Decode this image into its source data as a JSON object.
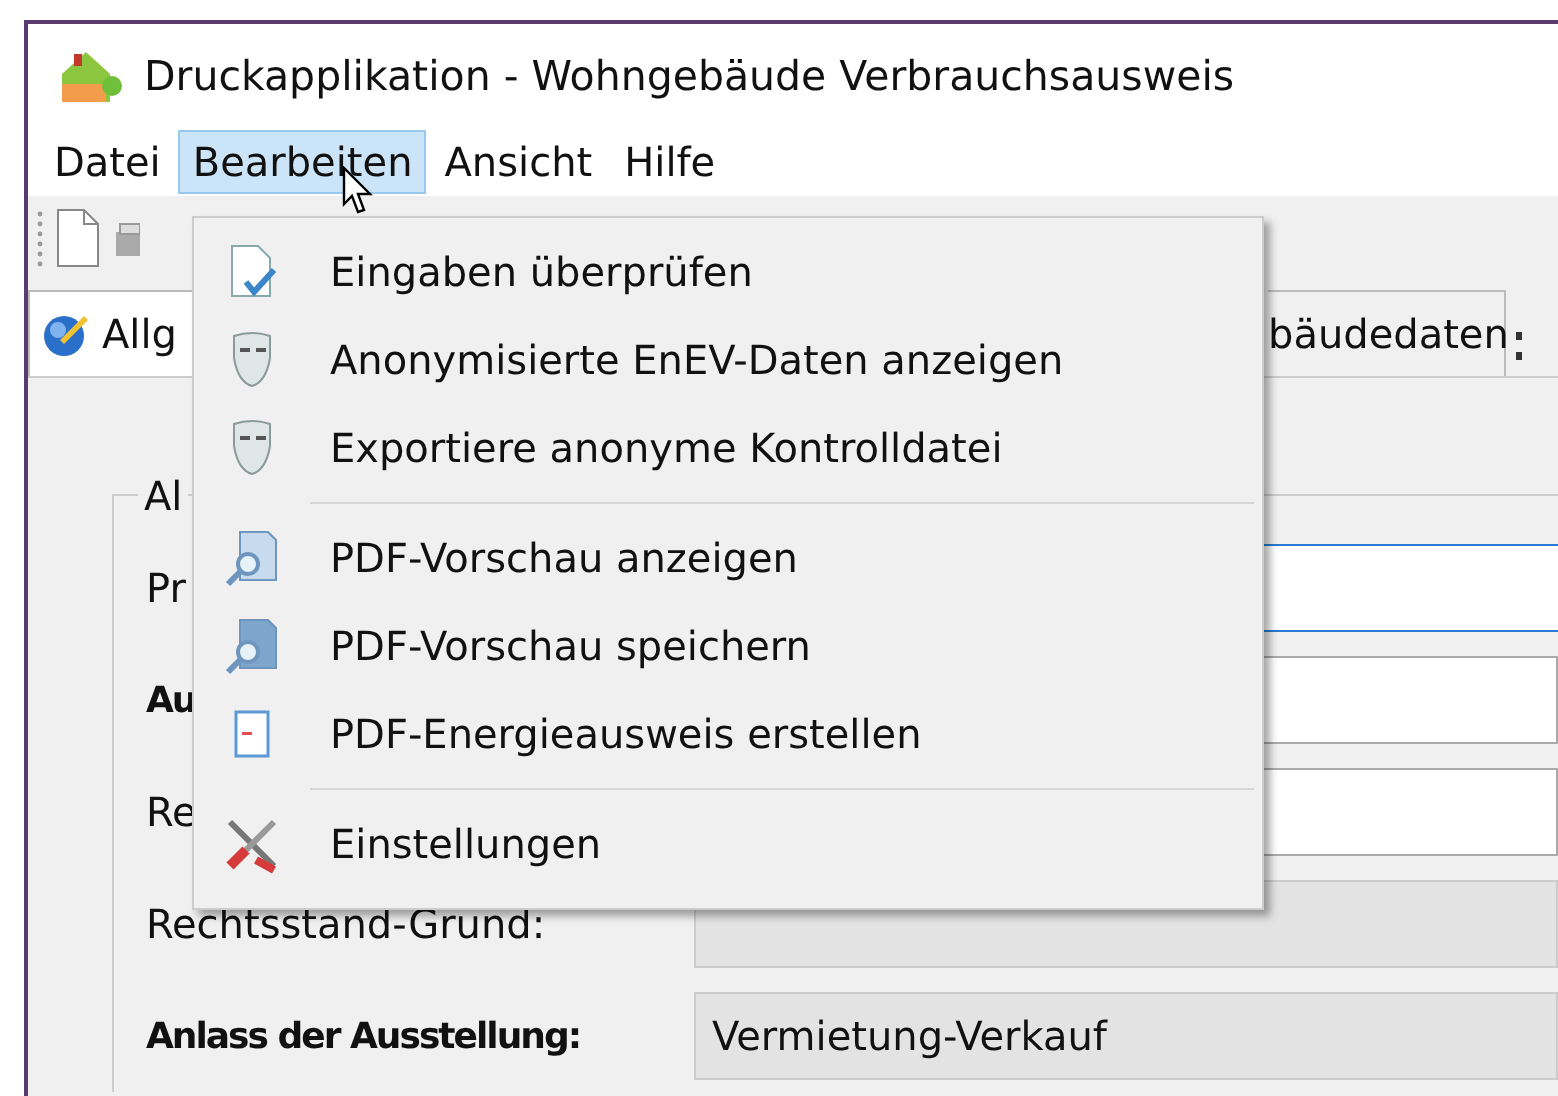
{
  "window": {
    "title": "Druckapplikation - Wohngebäude Verbrauchsausweis"
  },
  "menu_bar": [
    {
      "label": "Datei",
      "selected": false
    },
    {
      "label": "Bearbeiten",
      "selected": true
    },
    {
      "label": "Ansicht",
      "selected": false
    },
    {
      "label": "Hilfe",
      "selected": false
    }
  ],
  "tabs": [
    {
      "label": "Allg",
      "selected": true
    },
    {
      "label": "bäudedaten",
      "selected": false
    }
  ],
  "form": {
    "group_title": "Al",
    "fields": [
      {
        "label": "Pr",
        "required": false,
        "focused": true,
        "disabled": false
      },
      {
        "label": "Au",
        "required": true,
        "focused": false,
        "disabled": false
      },
      {
        "label": "Re",
        "required": false,
        "focused": false,
        "disabled": false
      },
      {
        "label": "Rechtsstand-Grund:",
        "required": false,
        "focused": false,
        "disabled": true
      },
      {
        "label": "Anlass der Ausstellung:",
        "required": true,
        "focused": false,
        "disabled": true,
        "value": "Vermietung-Verkauf"
      }
    ]
  },
  "dropdown_menu": [
    {
      "kind": "item",
      "label": "Eingaben überprüfen"
    },
    {
      "kind": "item",
      "label": "Anonymisierte EnEV-Daten anzeigen"
    },
    {
      "kind": "item",
      "label": "Exportiere anonyme Kontrolldatei"
    },
    {
      "kind": "separator"
    },
    {
      "kind": "item",
      "label": "PDF-Vorschau anzeigen"
    },
    {
      "kind": "item",
      "label": "PDF-Vorschau speichern"
    },
    {
      "kind": "item",
      "label": "PDF-Energieausweis erstellen"
    },
    {
      "kind": "separator"
    },
    {
      "kind": "item",
      "label": "Einstellungen"
    }
  ]
}
